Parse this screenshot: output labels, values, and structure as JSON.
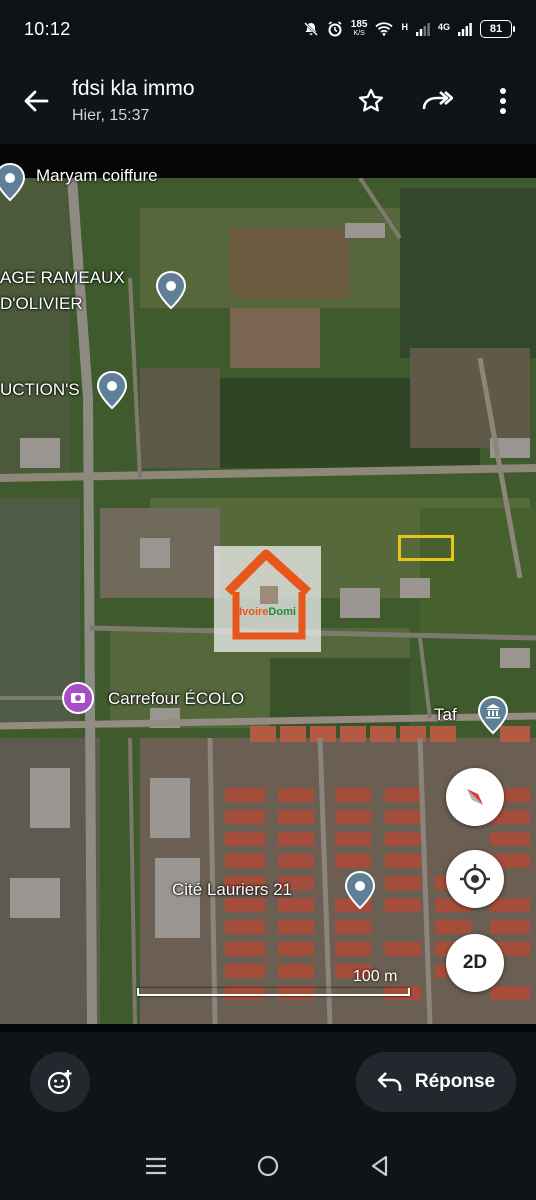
{
  "status_bar": {
    "time": "10:12",
    "net_speed": "185",
    "net_unit": "K/S",
    "signal_label_1": "H",
    "signal_label_2": "4G",
    "battery": "81"
  },
  "header": {
    "title": "fdsi kla immo",
    "subtitle": "Hier, 15:37",
    "icons": [
      "back-arrow-icon",
      "star-icon",
      "forward-icon",
      "more-vert-icon"
    ]
  },
  "map": {
    "labels": {
      "maryam": "Maryam coiffure",
      "rameaux_1": "AGE RAMEAUX",
      "rameaux_2": "D'OLIVIER",
      "uctions": "UCTION'S",
      "carrefour": "Carrefour ÉCOLO",
      "taf": "Taf",
      "cite": "Cité Lauriers 21"
    },
    "scale": "100 m",
    "button_2d": "2D",
    "logo_text_1": "Ivoire",
    "logo_text_2": "Domi",
    "colors": {
      "pin": "#5f7f96",
      "logo_orange": "#e8561c",
      "plot": "#e8c41a"
    }
  },
  "reply": {
    "label": "Réponse"
  }
}
